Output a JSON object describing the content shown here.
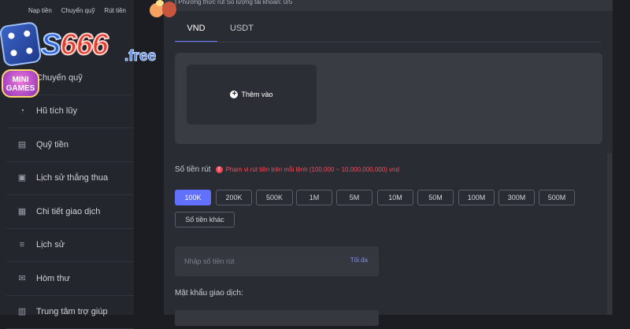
{
  "sidebar": {
    "top_items": [
      "Nạp tiền",
      "Chuyển quỹ",
      "Rút tiền"
    ],
    "items": [
      {
        "label": "Chuyển quỹ",
        "icon": "transfer-icon"
      },
      {
        "label": "Hũ tích lũy",
        "icon": "piggy-icon"
      },
      {
        "label": "Quỹ tiền",
        "icon": "wallet-icon"
      },
      {
        "label": "Lịch sử thắng thua",
        "icon": "clipboard-icon"
      },
      {
        "label": "Chi tiết giao dịch",
        "icon": "document-icon"
      },
      {
        "label": "Lịch sử",
        "icon": "history-icon"
      },
      {
        "label": "Hòm thư",
        "icon": "mail-icon"
      },
      {
        "label": "Trung tâm trợ giúp",
        "icon": "help-icon"
      }
    ]
  },
  "logo": {
    "text_s": "S",
    "text_num": "666",
    "text_free": ".free",
    "mini_games": "MINI GAMES"
  },
  "main": {
    "header_strip": "| Phương thức rút    Số lượng tài khoản: 0/5",
    "tabs": [
      {
        "label": "VND",
        "active": true
      },
      {
        "label": "USDT",
        "active": false
      }
    ],
    "add_card_label": "Thêm vào",
    "amount_label": "Số tiền rút",
    "range_note": "Phạm vi rút tiền trên mỗi lệnh   (100,000 ~ 10,000,000,000) vnd",
    "chips": [
      "100K",
      "200K",
      "500K",
      "1M",
      "5M",
      "10M",
      "50M",
      "100M",
      "300M",
      "500M",
      "Số tiền khác"
    ],
    "active_chip": "100K",
    "amount_input_placeholder": "Nhập số tiền rút",
    "max_label": "Tối đa",
    "password_label": "Mật khẩu giao dịch:"
  },
  "colors": {
    "accent": "#6170ff",
    "warning": "#f24b5a",
    "panel": "#2a2c33",
    "sidebar": "#24262d"
  }
}
